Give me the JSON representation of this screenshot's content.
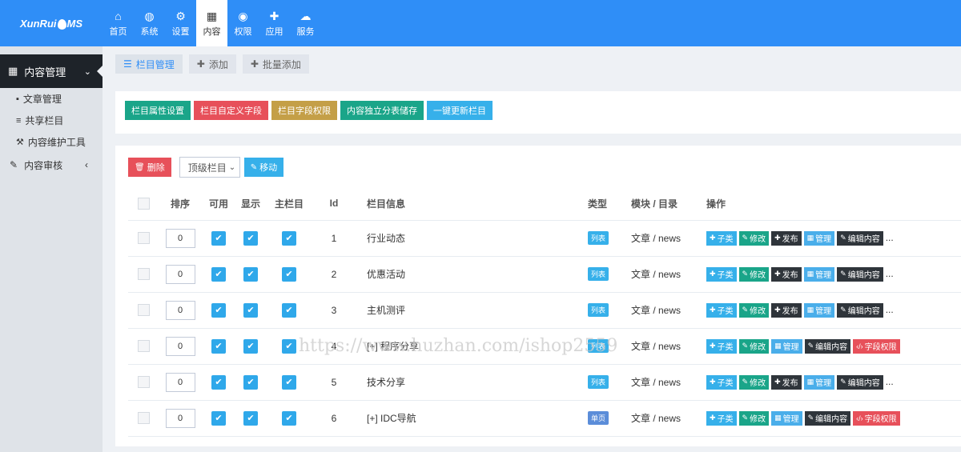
{
  "app": {
    "logo_text_left": "XunRui",
    "logo_text_right": "MS"
  },
  "nav": [
    {
      "icon": "home-icon",
      "glyph": "⌂",
      "label": "首页"
    },
    {
      "icon": "globe-icon",
      "glyph": "◍",
      "label": "系统"
    },
    {
      "icon": "cogs-icon",
      "glyph": "⚙",
      "label": "设置"
    },
    {
      "icon": "grid-icon",
      "glyph": "▦",
      "label": "内容",
      "active": true
    },
    {
      "icon": "user-icon",
      "glyph": "◉",
      "label": "权限"
    },
    {
      "icon": "puzzle-icon",
      "glyph": "✚",
      "label": "应用"
    },
    {
      "icon": "cloud-icon",
      "glyph": "☁",
      "label": "服务"
    }
  ],
  "sidebar": {
    "section": "内容管理",
    "items": [
      {
        "icon": "book-icon",
        "glyph": "▪",
        "label": "文章管理"
      },
      {
        "icon": "list-icon",
        "glyph": "≡",
        "label": "共享栏目"
      },
      {
        "icon": "wrench-icon",
        "glyph": "⚒",
        "label": "内容维护工具"
      }
    ],
    "group": "内容审核"
  },
  "toolbar": {
    "manage": "栏目管理",
    "add": "添加",
    "batch_add": "批量添加"
  },
  "config_buttons": [
    {
      "label": "栏目属性设置",
      "color": "#1aa589"
    },
    {
      "label": "栏目自定义字段",
      "color": "#e7505a"
    },
    {
      "label": "栏目字段权限",
      "color": "#c49f47"
    },
    {
      "label": "内容独立分表储存",
      "color": "#1aa589"
    },
    {
      "label": "一键更新栏目",
      "color": "#36b0ea"
    }
  ],
  "actions": {
    "delete": "删除",
    "select_value": "顶级栏目",
    "move": "移动"
  },
  "table": {
    "headers": [
      "排序",
      "可用",
      "显示",
      "主栏目",
      "Id",
      "栏目信息",
      "类型",
      "模块 / 目录",
      "操作"
    ],
    "rows": [
      {
        "order": "0",
        "id": "1",
        "name": "行业动态",
        "type": "列表",
        "module": "文章 / news",
        "ops": [
          "子类",
          "修改",
          "发布",
          "管理",
          "编辑内容"
        ],
        "more": "..."
      },
      {
        "order": "0",
        "id": "2",
        "name": "优惠活动",
        "type": "列表",
        "module": "文章 / news",
        "ops": [
          "子类",
          "修改",
          "发布",
          "管理",
          "编辑内容"
        ],
        "more": "..."
      },
      {
        "order": "0",
        "id": "3",
        "name": "主机测评",
        "type": "列表",
        "module": "文章 / news",
        "ops": [
          "子类",
          "修改",
          "发布",
          "管理",
          "编辑内容"
        ],
        "more": "..."
      },
      {
        "order": "0",
        "id": "4",
        "name": "[+] 程序分享",
        "type": "列表",
        "module": "文章 / news",
        "ops": [
          "子类",
          "修改",
          "管理",
          "编辑内容",
          "字段权限"
        ],
        "more": ""
      },
      {
        "order": "0",
        "id": "5",
        "name": "技术分享",
        "type": "列表",
        "module": "文章 / news",
        "ops": [
          "子类",
          "修改",
          "发布",
          "管理",
          "编辑内容"
        ],
        "more": "..."
      },
      {
        "order": "0",
        "id": "6",
        "name": "[+] IDC导航",
        "type": "单页",
        "module": "文章 / news",
        "ops": [
          "子类",
          "修改",
          "管理",
          "编辑内容",
          "字段权限"
        ],
        "more": ""
      }
    ]
  },
  "watermark": "https://www.huzhan.com/ishop2559"
}
